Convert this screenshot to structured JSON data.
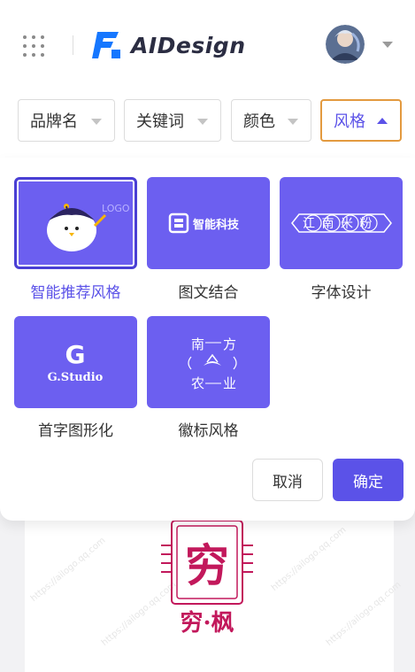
{
  "header": {
    "menu_icon": "apps-grid-icon",
    "brand": "AIDesign",
    "logo_icon": "aidesign-logo-icon",
    "avatar_icon": "user-avatar",
    "dropdown_icon": "chevron-down-icon"
  },
  "filters": [
    {
      "label": "品牌名",
      "active": false
    },
    {
      "label": "关键词",
      "active": false
    },
    {
      "label": "颜色",
      "active": false
    },
    {
      "label": "风格",
      "active": true
    }
  ],
  "styles": [
    {
      "label": "智能推荐风格",
      "selected": true,
      "preview_text": "LOGO"
    },
    {
      "label": "图文结合",
      "selected": false,
      "preview_text": "智能科技"
    },
    {
      "label": "字体设计",
      "selected": false,
      "preview_text": "江南米粉"
    },
    {
      "label": "首字图形化",
      "selected": false,
      "preview_text": "G.Studio"
    },
    {
      "label": "徽标风格",
      "selected": false,
      "preview_text": [
        "南",
        "方",
        "农",
        "业"
      ]
    }
  ],
  "actions": {
    "cancel": "取消",
    "confirm": "确定"
  },
  "background_card": {
    "logo_char": "穷",
    "logo_name": "穷·枫",
    "watermark": "https://ailogo.qq.com"
  },
  "colors": {
    "accent": "#5b52e8",
    "tile_bg": "#6c5ff0",
    "active_border": "#e39a3f",
    "logo_red": "#c2185b"
  }
}
